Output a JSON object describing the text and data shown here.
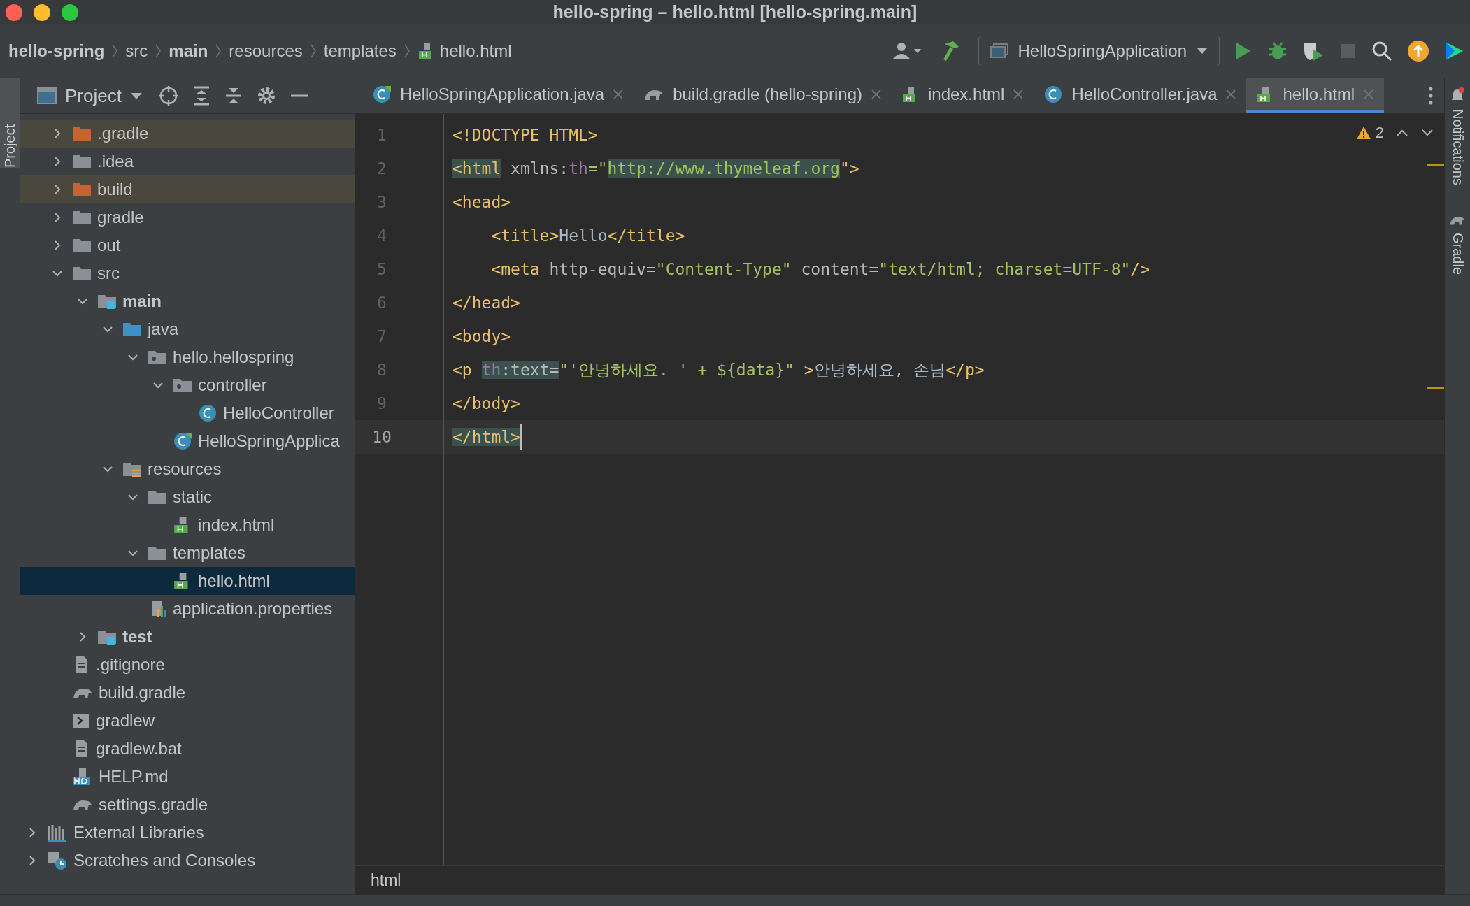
{
  "window": {
    "title": "hello-spring – hello.html [hello-spring.main]"
  },
  "breadcrumbs": [
    {
      "label": "hello-spring",
      "bold": true,
      "kind": "none"
    },
    {
      "label": "src",
      "bold": false,
      "kind": "none"
    },
    {
      "label": "main",
      "bold": true,
      "kind": "none"
    },
    {
      "label": "resources",
      "bold": false,
      "kind": "none"
    },
    {
      "label": "templates",
      "bold": false,
      "kind": "none"
    },
    {
      "label": "hello.html",
      "bold": false,
      "kind": "html"
    }
  ],
  "run_config": {
    "label": "HelloSpringApplication"
  },
  "left_stripe": {
    "label": "Project"
  },
  "project_panel": {
    "title": "Project",
    "tree": [
      {
        "label": ".gradle",
        "kind": "folder",
        "excluded": true,
        "expanded": false,
        "bold": false,
        "selected": false
      },
      {
        "label": ".idea",
        "kind": "folder",
        "excluded": false,
        "expanded": false,
        "bold": false,
        "selected": false
      },
      {
        "label": "build",
        "kind": "folder",
        "excluded": true,
        "expanded": false,
        "bold": false,
        "selected": false
      },
      {
        "label": "gradle",
        "kind": "folder",
        "excluded": false,
        "expanded": false,
        "bold": false,
        "selected": false
      },
      {
        "label": "out",
        "kind": "folder",
        "excluded": false,
        "expanded": false,
        "bold": false,
        "selected": false
      },
      {
        "label": "src",
        "kind": "folder",
        "excluded": false,
        "expanded": true,
        "bold": false,
        "selected": false,
        "children": [
          {
            "label": "main",
            "kind": "module",
            "excluded": false,
            "expanded": true,
            "bold": true,
            "selected": false,
            "children": [
              {
                "label": "java",
                "kind": "source",
                "excluded": false,
                "expanded": true,
                "bold": false,
                "selected": false,
                "children": [
                  {
                    "label": "hello.hellospring",
                    "kind": "package",
                    "excluded": false,
                    "expanded": true,
                    "bold": false,
                    "selected": false,
                    "children": [
                      {
                        "label": "controller",
                        "kind": "package",
                        "excluded": false,
                        "expanded": true,
                        "bold": false,
                        "selected": false,
                        "children": [
                          {
                            "label": "HelloController",
                            "kind": "class",
                            "excluded": false,
                            "bold": false,
                            "selected": false
                          }
                        ]
                      },
                      {
                        "label": "HelloSpringApplica",
                        "kind": "spring",
                        "excluded": false,
                        "bold": false,
                        "selected": false
                      }
                    ]
                  }
                ]
              },
              {
                "label": "resources",
                "kind": "resources",
                "excluded": false,
                "expanded": true,
                "bold": false,
                "selected": false,
                "children": [
                  {
                    "label": "static",
                    "kind": "folder",
                    "excluded": false,
                    "expanded": true,
                    "bold": false,
                    "selected": false,
                    "children": [
                      {
                        "label": "index.html",
                        "kind": "html",
                        "excluded": false,
                        "bold": false,
                        "selected": false
                      }
                    ]
                  },
                  {
                    "label": "templates",
                    "kind": "folder",
                    "excluded": false,
                    "expanded": true,
                    "bold": false,
                    "selected": false,
                    "children": [
                      {
                        "label": "hello.html",
                        "kind": "html",
                        "excluded": false,
                        "bold": false,
                        "selected": true
                      }
                    ]
                  },
                  {
                    "label": "application.properties",
                    "kind": "properties",
                    "excluded": false,
                    "bold": false,
                    "selected": false
                  }
                ]
              }
            ]
          },
          {
            "label": "test",
            "kind": "module",
            "excluded": false,
            "expanded": false,
            "bold": true,
            "selected": false
          }
        ]
      },
      {
        "label": ".gitignore",
        "kind": "file",
        "excluded": false,
        "bold": false,
        "selected": false
      },
      {
        "label": "build.gradle",
        "kind": "gradle",
        "excluded": false,
        "bold": false,
        "selected": false
      },
      {
        "label": "gradlew",
        "kind": "terminal",
        "excluded": false,
        "bold": false,
        "selected": false
      },
      {
        "label": "gradlew.bat",
        "kind": "file",
        "excluded": false,
        "bold": false,
        "selected": false
      },
      {
        "label": "HELP.md",
        "kind": "markdown",
        "excluded": false,
        "bold": false,
        "selected": false
      },
      {
        "label": "settings.gradle",
        "kind": "gradle",
        "excluded": false,
        "bold": false,
        "selected": false
      }
    ]
  },
  "bottom_tree": [
    {
      "label": "External Libraries",
      "kind": "libraries",
      "expanded": false,
      "selected": false
    },
    {
      "label": "Scratches and Consoles",
      "kind": "scratches",
      "expanded": false,
      "selected": false
    }
  ],
  "tabs": [
    {
      "label": "HelloSpringApplication.java",
      "kind": "spring",
      "selected": false
    },
    {
      "label": "build.gradle (hello-spring)",
      "kind": "gradle",
      "selected": false
    },
    {
      "label": "index.html",
      "kind": "html",
      "selected": false
    },
    {
      "label": "HelloController.java",
      "kind": "class",
      "selected": false
    },
    {
      "label": "hello.html",
      "kind": "html",
      "selected": true
    }
  ],
  "editor": {
    "warnings": "2",
    "lines": [
      {
        "number": "1",
        "current": false,
        "tokens": [
          {
            "text": "<!DOCTYPE HTML>",
            "kind": "tag",
            "highlighted": false
          }
        ]
      },
      {
        "number": "2",
        "current": false,
        "tokens": [
          {
            "text": "<html",
            "kind": "tag",
            "highlighted": true
          },
          {
            "text": " xmlns:",
            "kind": "attr",
            "highlighted": false
          },
          {
            "text": "th",
            "kind": "ns",
            "highlighted": false
          },
          {
            "text": "=\"",
            "kind": "value",
            "highlighted": false
          },
          {
            "text": "http://www.thymeleaf.org",
            "kind": "value",
            "highlighted": true
          },
          {
            "text": "\">",
            "kind": "tag",
            "highlighted": false
          }
        ]
      },
      {
        "number": "3",
        "current": false,
        "tokens": [
          {
            "text": "<head>",
            "kind": "tag",
            "highlighted": false
          }
        ]
      },
      {
        "number": "4",
        "current": false,
        "tokens": [
          {
            "text": "    <title>",
            "kind": "tag",
            "highlighted": false
          },
          {
            "text": "Hello",
            "kind": "text",
            "highlighted": false
          },
          {
            "text": "</title>",
            "kind": "tag",
            "highlighted": false
          }
        ]
      },
      {
        "number": "5",
        "current": false,
        "tokens": [
          {
            "text": "    <meta",
            "kind": "tag",
            "highlighted": false
          },
          {
            "text": " http-equiv=",
            "kind": "attr",
            "highlighted": false
          },
          {
            "text": "\"Content-Type\"",
            "kind": "value",
            "highlighted": false
          },
          {
            "text": " content=",
            "kind": "attr",
            "highlighted": false
          },
          {
            "text": "\"text/html; charset=UTF-8\"",
            "kind": "value",
            "highlighted": false
          },
          {
            "text": "/>",
            "kind": "tag",
            "highlighted": false
          }
        ]
      },
      {
        "number": "6",
        "current": false,
        "tokens": [
          {
            "text": "</head>",
            "kind": "tag",
            "highlighted": false
          }
        ]
      },
      {
        "number": "7",
        "current": false,
        "tokens": [
          {
            "text": "<body>",
            "kind": "tag",
            "highlighted": false
          }
        ]
      },
      {
        "number": "8",
        "current": false,
        "tokens": [
          {
            "text": "<p ",
            "kind": "tag",
            "highlighted": false
          },
          {
            "text": "th",
            "kind": "ns",
            "highlighted": true
          },
          {
            "text": ":text=",
            "kind": "attr",
            "highlighted": true
          },
          {
            "text": "\"'안녕하세요. ' + ${data}\"",
            "kind": "value",
            "highlighted": false
          },
          {
            "text": " >",
            "kind": "tag",
            "highlighted": false
          },
          {
            "text": "안녕하세요, 손님",
            "kind": "text",
            "highlighted": false
          },
          {
            "text": "</p>",
            "kind": "tag",
            "highlighted": false
          }
        ]
      },
      {
        "number": "9",
        "current": false,
        "tokens": [
          {
            "text": "</body>",
            "kind": "tag",
            "highlighted": false
          }
        ]
      },
      {
        "number": "10",
        "current": true,
        "tokens": [
          {
            "text": "</html>",
            "kind": "tag",
            "highlighted": true
          }
        ]
      }
    ]
  },
  "editor_breadcrumb": "html",
  "right_stripe": [
    {
      "label": "Notifications"
    },
    {
      "label": "Gradle"
    }
  ]
}
